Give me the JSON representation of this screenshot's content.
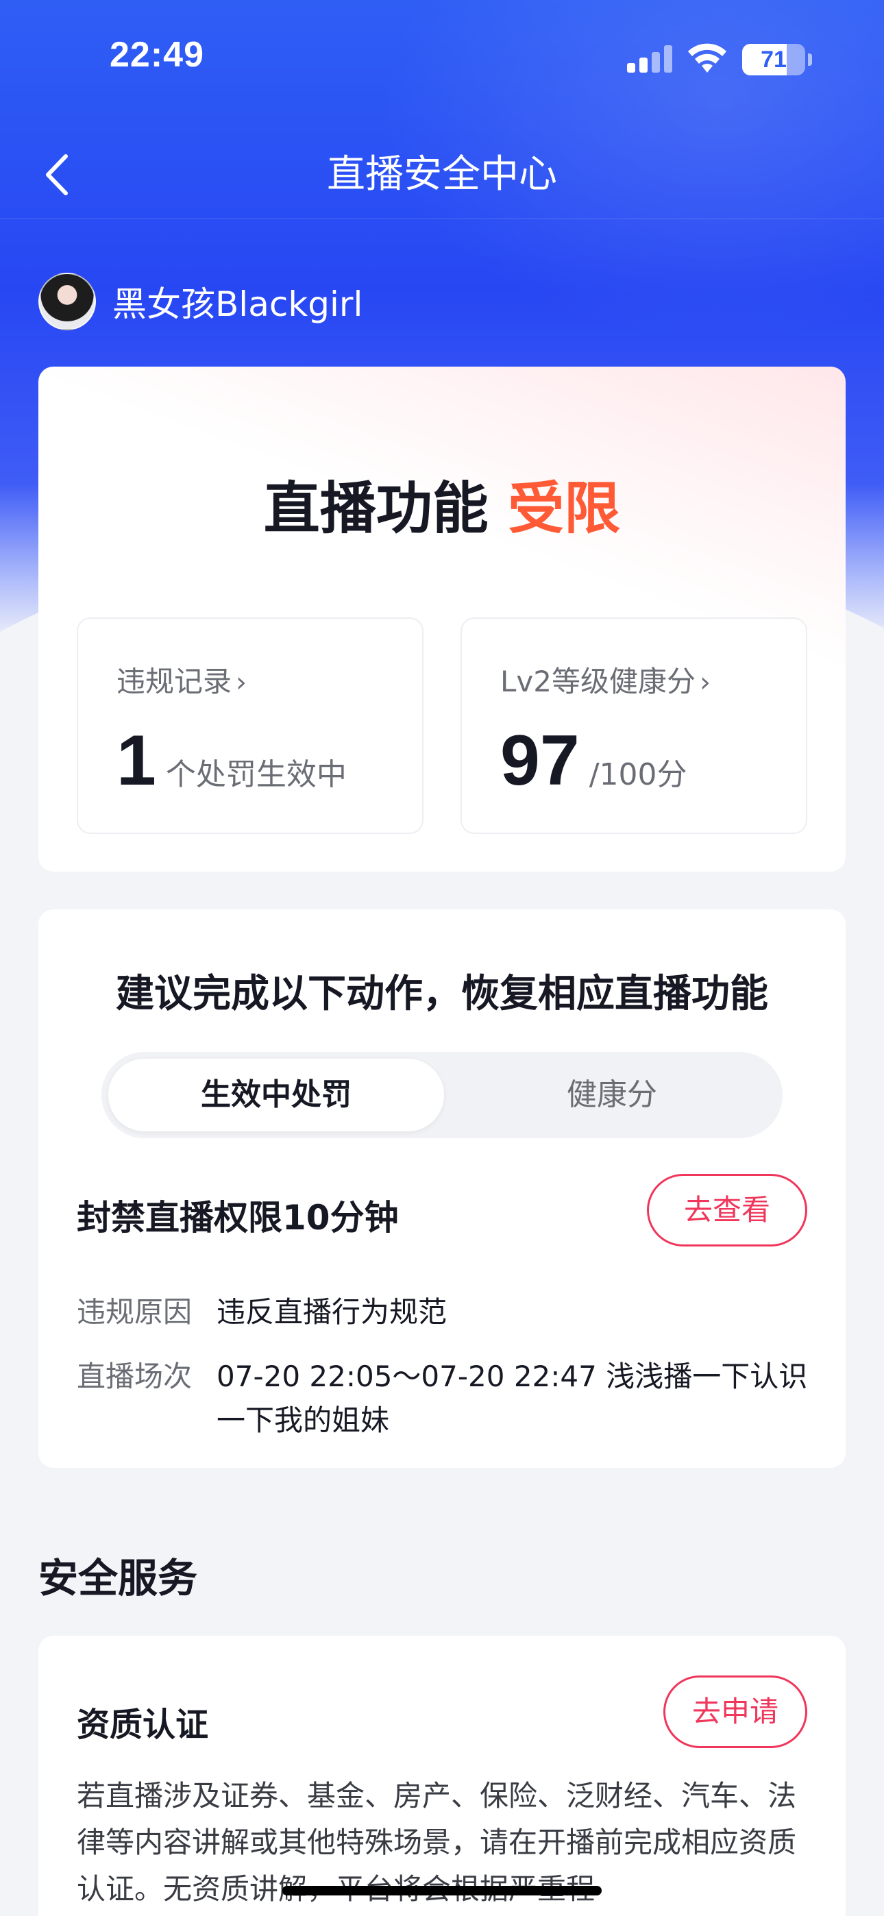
{
  "status_bar": {
    "time": "22:49",
    "battery": "71",
    "battery_level": 0.71
  },
  "nav": {
    "title": "直播安全中心",
    "back_icon": "chevron-left-icon"
  },
  "user": {
    "name": "黑女孩Blackgirl"
  },
  "status_card": {
    "title_prefix": "直播功能",
    "title_status": "受限",
    "violations": {
      "label": "违规记录",
      "value": "1",
      "unit": "个处罚生效中"
    },
    "health": {
      "label": "Lv2等级健康分",
      "value": "97",
      "unit": "/100分"
    },
    "chevron": "›"
  },
  "suggestion": {
    "title": "建议完成以下动作，恢复相应直播功能",
    "tabs": [
      {
        "label": "生效中处罚",
        "active": true
      },
      {
        "label": "健康分",
        "active": false
      }
    ],
    "penalty": {
      "title": "封禁直播权限10分钟",
      "action": "去查看",
      "reason_key": "违规原因",
      "reason_value": "违反直播行为规范",
      "session_key": "直播场次",
      "session_value": "07-20 22:05～07-20 22:47 浅浅播一下认识一下我的姐妹"
    }
  },
  "services": {
    "heading": "安全服务",
    "items": [
      {
        "title": "资质认证",
        "action": "去申请",
        "description": "若直播涉及证券、基金、房产、保险、泛财经、汽车、法律等内容讲解或其他特殊场景，请在开播前完成相应资质认证。无资质讲解，平台将会根据严重程"
      }
    ]
  },
  "colors": {
    "brand_blue": "#2747f3",
    "warning": "#fe5a36",
    "accent_red": "#f0365b"
  }
}
